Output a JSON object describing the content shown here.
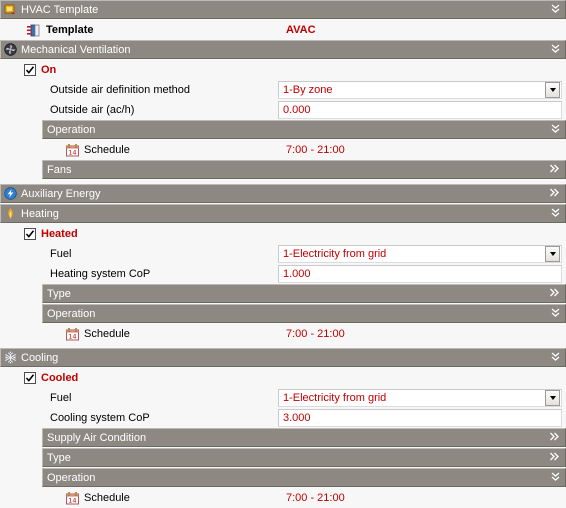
{
  "panel": {
    "sections": [
      {
        "id": "hvac-template",
        "label": "HVAC Template",
        "icon": "hvac-template-icon",
        "state": "expanded",
        "chevron": "»»"
      },
      {
        "id": "mechanical-ventilation",
        "label": "Mechanical Ventilation",
        "icon": "fan-icon",
        "state": "expanded"
      },
      {
        "id": "operation-ventilation",
        "label": "Operation",
        "state": "expanded"
      },
      {
        "id": "fans",
        "label": "Fans",
        "state": "collapsed"
      },
      {
        "id": "auxiliary-energy",
        "label": "Auxiliary Energy",
        "icon": "lightning-icon",
        "state": "collapsed"
      },
      {
        "id": "heating",
        "label": "Heating",
        "icon": "flame-icon",
        "state": "expanded"
      },
      {
        "id": "heating-type",
        "label": "Type",
        "state": "collapsed"
      },
      {
        "id": "heating-operation",
        "label": "Operation",
        "state": "expanded"
      },
      {
        "id": "cooling",
        "label": "Cooling",
        "icon": "snowflake-icon",
        "state": "expanded"
      },
      {
        "id": "supply-air-condition",
        "label": "Supply Air Condition",
        "state": "collapsed"
      },
      {
        "id": "cooling-type",
        "label": "Type",
        "state": "collapsed"
      },
      {
        "id": "cooling-operation",
        "label": "Operation",
        "state": "expanded"
      }
    ],
    "template_row": {
      "label": "Template",
      "value": "AVAC",
      "icon": "template-icon"
    },
    "ventilation": {
      "on_checkbox": {
        "label": "On",
        "checked": true
      },
      "outside_air_method": {
        "label": "Outside air definition method",
        "value": "1-By zone",
        "control": "dropdown"
      },
      "outside_air_ach": {
        "label": "Outside air (ac/h)",
        "value": "0.000",
        "control": "text"
      },
      "schedule": {
        "label": "Schedule",
        "value": "7:00 - 21:00",
        "icon": "calendar-icon"
      }
    },
    "heating": {
      "heated_checkbox": {
        "label": "Heated",
        "checked": true
      },
      "fuel": {
        "label": "Fuel",
        "value": "1-Electricity from grid",
        "control": "dropdown"
      },
      "cop": {
        "label": "Heating system CoP",
        "value": "1.000",
        "control": "text"
      },
      "schedule": {
        "label": "Schedule",
        "value": "7:00 - 21:00",
        "icon": "calendar-icon"
      }
    },
    "cooling": {
      "cooled_checkbox": {
        "label": "Cooled",
        "checked": true
      },
      "fuel": {
        "label": "Fuel",
        "value": "1-Electricity from grid",
        "control": "dropdown"
      },
      "cop": {
        "label": "Cooling system CoP",
        "value": "3.000",
        "control": "text"
      },
      "schedule": {
        "label": "Schedule",
        "value": "7:00 - 21:00",
        "icon": "calendar-icon"
      }
    },
    "glyphs": {
      "expanded": "ˇˇ",
      "collapsed": "»"
    },
    "colors": {
      "header_bar": "#8d8882",
      "value_text": "#c00000",
      "background": "#f7f7f7",
      "label_text": "#000000"
    }
  }
}
